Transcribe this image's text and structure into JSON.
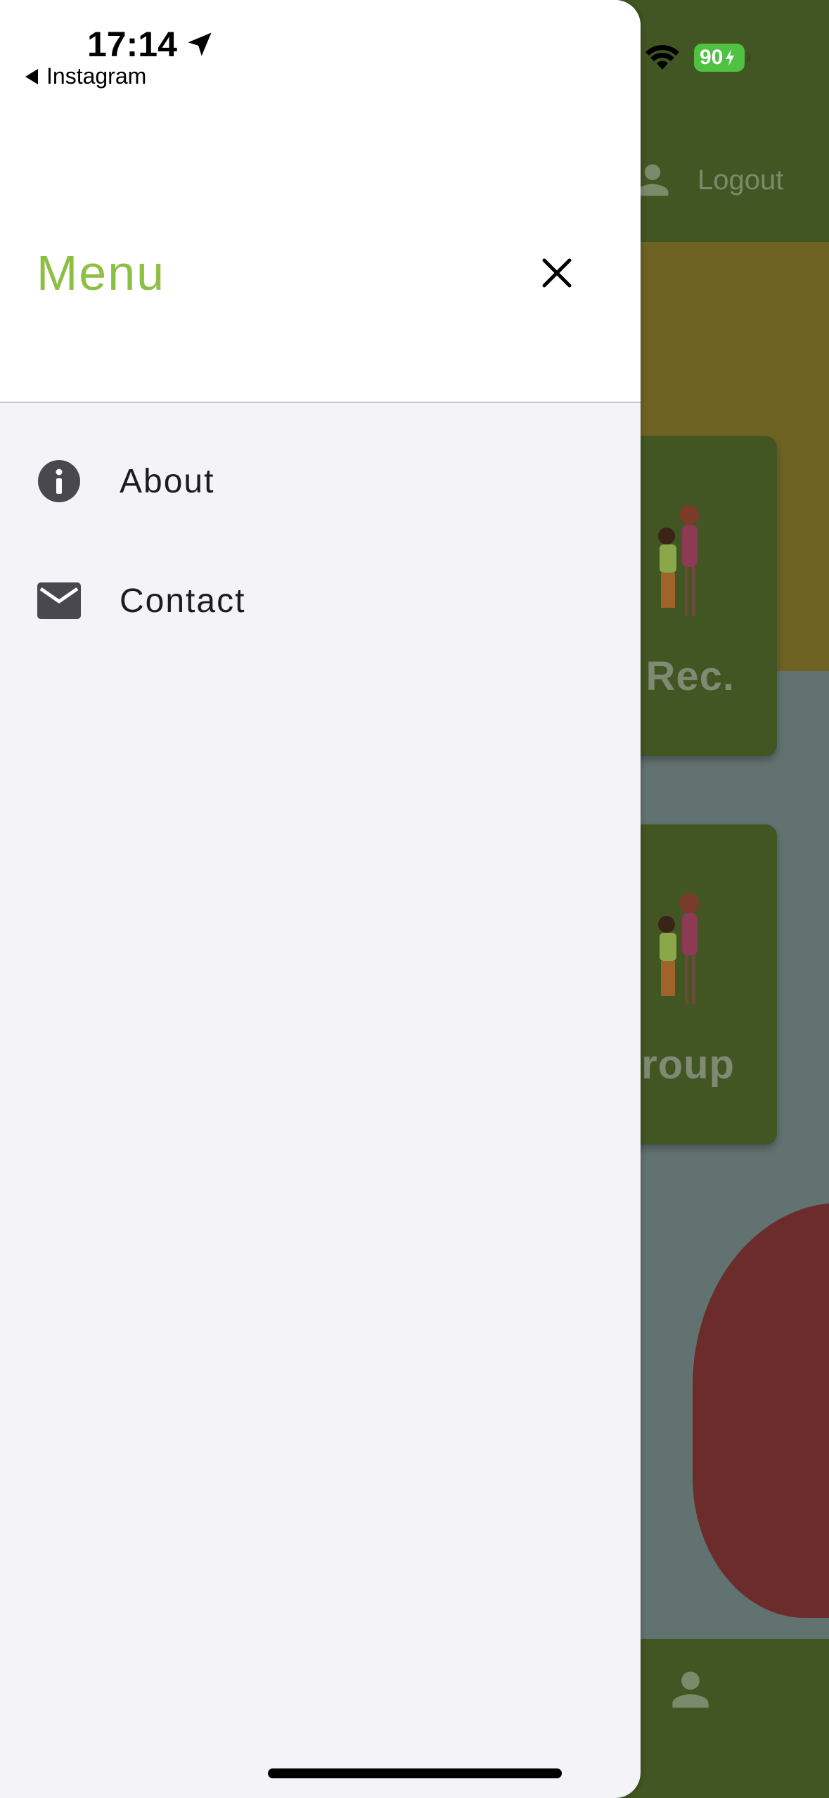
{
  "status_bar": {
    "time": "17:14",
    "back_app": "Instagram",
    "battery": "90"
  },
  "background": {
    "logout_label": "Logout",
    "card1_label": "Rec.",
    "card2_label": "Group"
  },
  "drawer": {
    "title": "Menu",
    "items": [
      {
        "label": "About",
        "icon": "info-icon"
      },
      {
        "label": "Contact",
        "icon": "mail-icon"
      }
    ]
  },
  "colors": {
    "menu_title": "#8dbf45",
    "drawer_bg": "#f3f3f8",
    "header_bg": "#ffffff",
    "bg_green": "#425623",
    "bg_teal": "#627271",
    "bg_red": "#6c2c2c"
  }
}
